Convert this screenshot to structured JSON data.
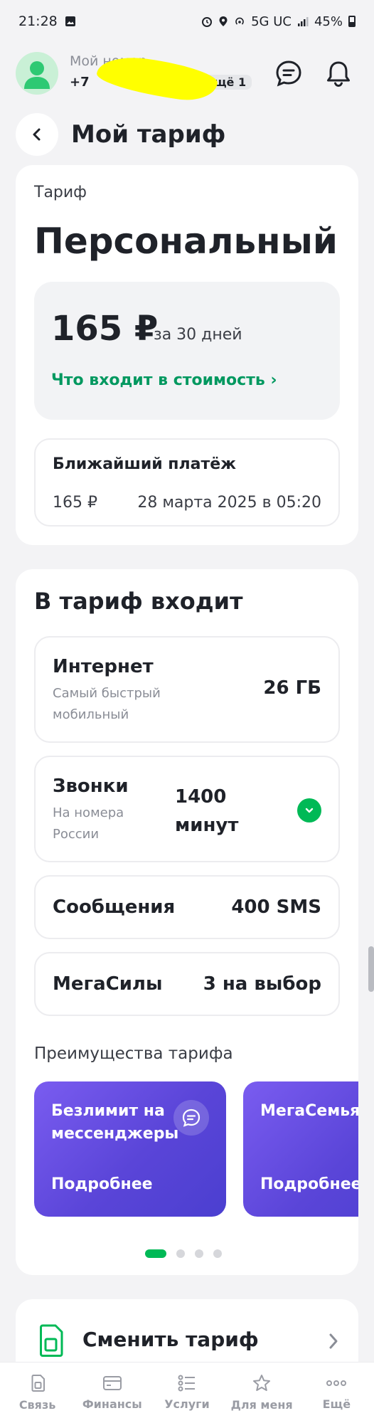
{
  "status_bar": {
    "time": "21:28",
    "network": "5G UC",
    "battery": "45%"
  },
  "profile": {
    "name": "Мой номер",
    "phone": "+7",
    "more_badge": "ещё 1"
  },
  "page": {
    "title": "Мой тариф"
  },
  "tariff": {
    "label": "Тариф",
    "name": "Персональный",
    "price": "165 ₽",
    "period": "за 30 дней",
    "details_link": "Что входит в стоимость ›",
    "next_payment": {
      "title": "Ближайший платёж",
      "amount": "165 ₽",
      "date": "28 марта 2025 в 05:20"
    }
  },
  "includes": {
    "title": "В тариф входит",
    "services": [
      {
        "title": "Интернет",
        "subtitle": "Самый быстрый мобильный",
        "value": "26 ГБ"
      },
      {
        "title": "Звонки",
        "subtitle": "На номера России",
        "value": "1400 минут"
      },
      {
        "title": "Сообщения",
        "value": "400 SMS"
      },
      {
        "title": "МегаСилы",
        "value": "3 на выбор"
      }
    ],
    "benefits_title": "Преимущества тарифа",
    "benefits": [
      {
        "title": "Безлимит на мессенджеры",
        "more": "Подробнее"
      },
      {
        "title": "МегаСемья",
        "more": "Подробнее"
      }
    ],
    "carousel": {
      "pages": 4,
      "active": 1
    }
  },
  "change_tariff": {
    "label": "Сменить тариф"
  },
  "bottom_nav": [
    {
      "label": "Связь"
    },
    {
      "label": "Финансы"
    },
    {
      "label": "Услуги"
    },
    {
      "label": "Для меня"
    },
    {
      "label": "Ещё"
    }
  ],
  "colors": {
    "accent_green": "#00b956",
    "link_green": "#00985f",
    "benefit_purple": "#5a45d8",
    "background": "#f3f3f5"
  }
}
